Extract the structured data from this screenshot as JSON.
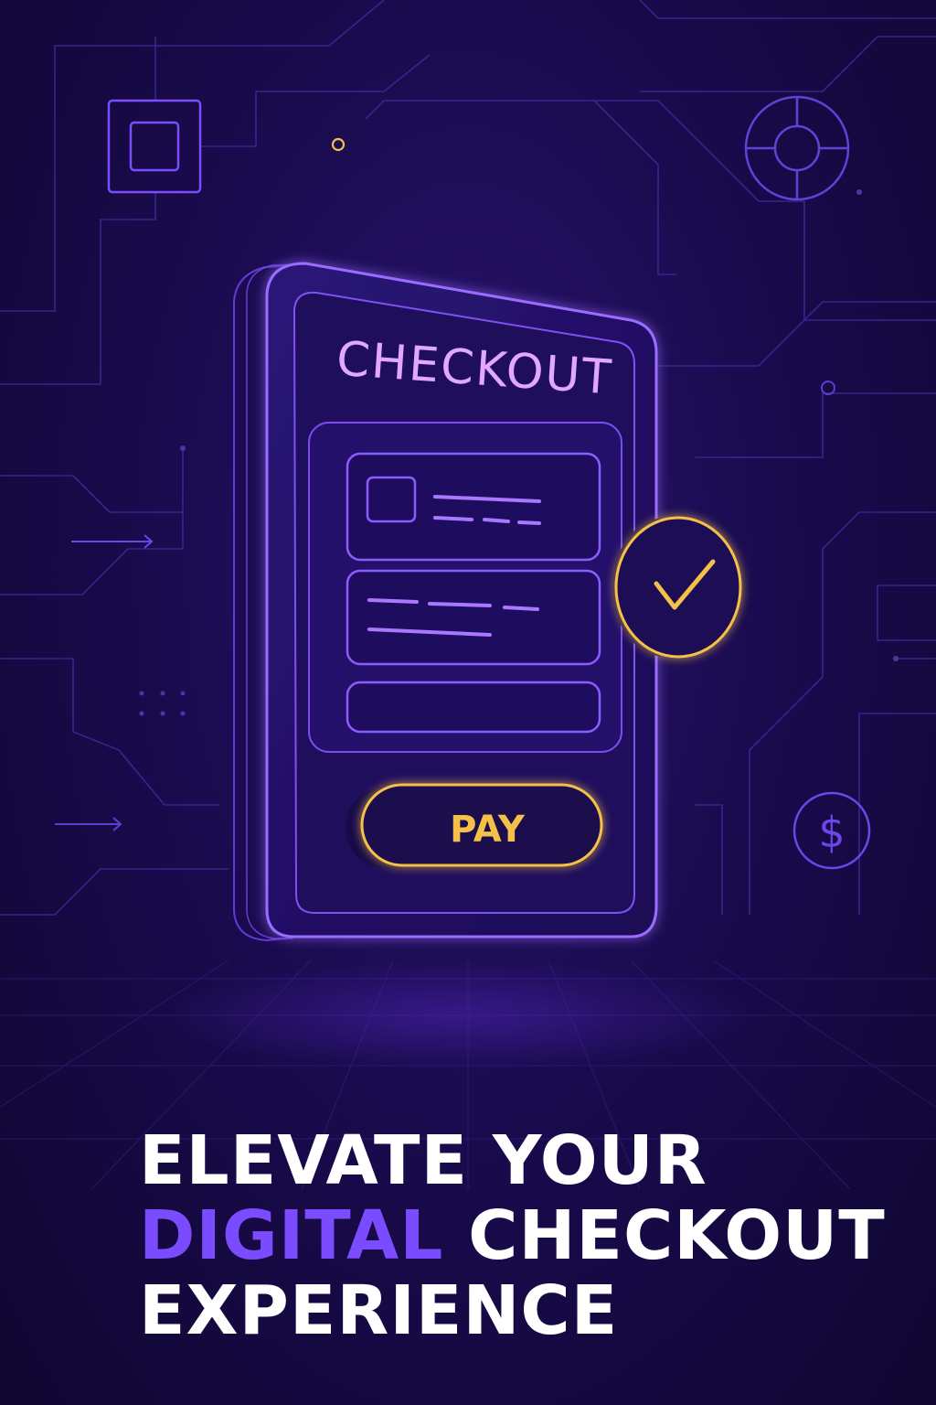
{
  "device": {
    "title": "CHECKOUT",
    "pay_label": "PAY"
  },
  "icons": [
    "square-chip-icon",
    "target-ring-icon",
    "dollar-icon",
    "check-icon",
    "card-icon",
    "arrow-right-icon"
  ],
  "colors": {
    "background": "#1a0b4f",
    "neon_purple": "#8c5cff",
    "title_pink": "#e2a8ff",
    "gold": "#f5c04a",
    "accent_text": "#7b4bff",
    "white": "#ffffff"
  },
  "headline": {
    "line1": "ELEVATE YOUR",
    "line2_accent": "DIGITAL",
    "line2_rest": "CHECKOUT",
    "line3": "EXPERIENCE"
  }
}
